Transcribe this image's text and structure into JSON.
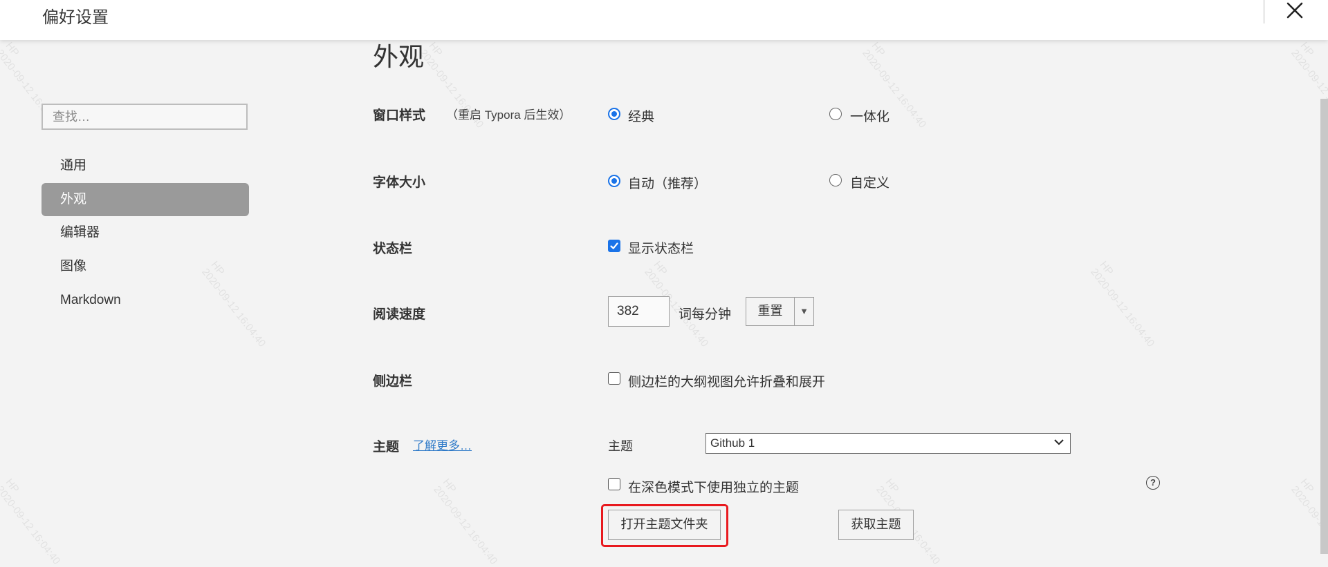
{
  "header": {
    "title": "偏好设置",
    "close_icon": "close-icon"
  },
  "sidebar": {
    "search_placeholder": "查找…",
    "items": [
      {
        "label": "通用",
        "active": false
      },
      {
        "label": "外观",
        "active": true
      },
      {
        "label": "编辑器",
        "active": false
      },
      {
        "label": "图像",
        "active": false
      },
      {
        "label": "Markdown",
        "active": false
      }
    ]
  },
  "main": {
    "section_title": "外观",
    "window_style": {
      "label": "窗口样式",
      "note": "（重启 Typora 后生效）",
      "options": [
        {
          "label": "经典",
          "selected": true
        },
        {
          "label": "一体化",
          "selected": false
        }
      ]
    },
    "font_size": {
      "label": "字体大小",
      "options": [
        {
          "label": "自动（推荐）",
          "selected": true
        },
        {
          "label": "自定义",
          "selected": false
        }
      ]
    },
    "status_bar": {
      "label": "状态栏",
      "checkbox_label": "显示状态栏",
      "checked": true
    },
    "reading_speed": {
      "label": "阅读速度",
      "value": "382",
      "unit": "词每分钟",
      "reset_label": "重置",
      "dropdown_glyph": "▼"
    },
    "sidebar_opt": {
      "label": "侧边栏",
      "checkbox_label": "侧边栏的大纲视图允许折叠和展开",
      "checked": false
    },
    "theme": {
      "label": "主题",
      "learn_more": "了解更多…",
      "field_label": "主题",
      "selected": "Github 1",
      "dark_mode_label": "在深色模式下使用独立的主题",
      "dark_mode_checked": false,
      "help_glyph": "?",
      "open_folder_label": "打开主题文件夹",
      "get_themes_label": "获取主题"
    }
  },
  "watermark": {
    "line1": "HP",
    "line2": "2020-09-12 16:04:40"
  },
  "colors": {
    "accent": "#1a73e8",
    "highlight": "#e8191e",
    "active_nav": "#9a9a9a",
    "link": "#2f7ac8"
  }
}
